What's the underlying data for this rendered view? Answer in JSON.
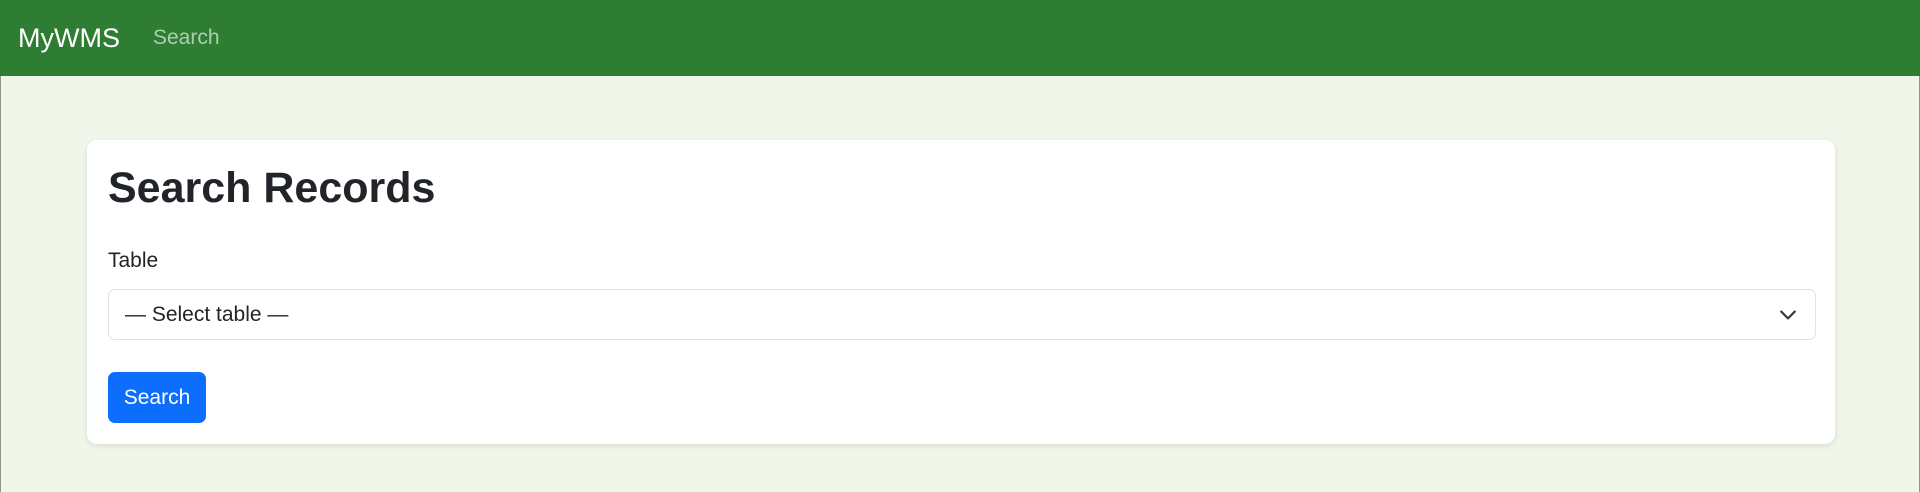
{
  "navbar": {
    "brand": "MyWMS",
    "links": [
      "Search"
    ],
    "background_color": "#2e7d32"
  },
  "page": {
    "background_color": "#f0f6e9"
  },
  "card": {
    "title": "Search Records",
    "table_field": {
      "label": "Table",
      "selected_value": "— Select table —",
      "icon": "chevron-down-icon"
    },
    "search_button": {
      "label": "Search",
      "color": "#0d6efd"
    }
  }
}
